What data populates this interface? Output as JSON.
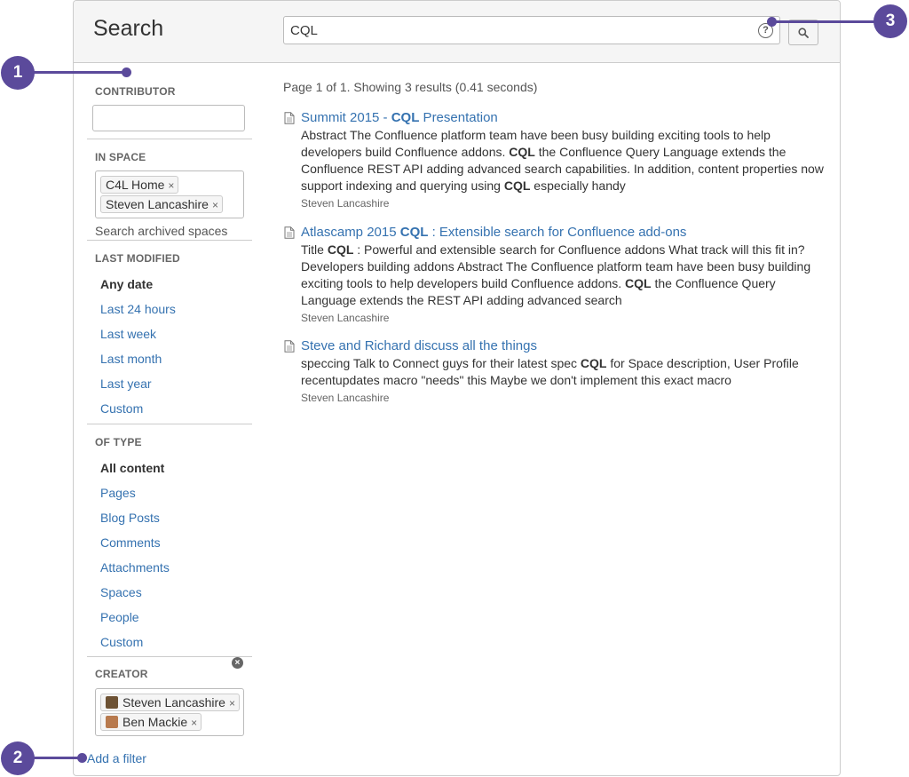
{
  "header": {
    "title": "Search",
    "query": "CQL",
    "help_glyph": "?"
  },
  "sidebar": {
    "contributor": {
      "title": "CONTRIBUTOR",
      "value": ""
    },
    "in_space": {
      "title": "IN SPACE",
      "chips": [
        "C4L Home",
        "Steven Lancashire"
      ],
      "archived_label": "Search archived spaces"
    },
    "last_modified": {
      "title": "LAST MODIFIED",
      "options": [
        "Any date",
        "Last 24 hours",
        "Last week",
        "Last month",
        "Last year",
        "Custom"
      ],
      "selected": "Any date"
    },
    "of_type": {
      "title": "OF TYPE",
      "options": [
        "All content",
        "Pages",
        "Blog Posts",
        "Comments",
        "Attachments",
        "Spaces",
        "People",
        "Custom"
      ],
      "selected": "All content"
    },
    "creator": {
      "title": "CREATOR",
      "chips": [
        "Steven Lancashire",
        "Ben Mackie"
      ]
    },
    "add_filter": "Add a filter",
    "chip_remove_glyph": "×"
  },
  "results": {
    "summary": "Page 1 of 1. Showing 3 results (0.41 seconds)",
    "items": [
      {
        "title_pre": "Summit 2015 - ",
        "title_bold": "CQL",
        "title_post": " Presentation",
        "excerpt": [
          {
            "t": "Abstract The Confluence platform team have been busy building exciting tools to help developers build Confluence addons. "
          },
          {
            "b": "CQL"
          },
          {
            "t": " the Confluence Query Language extends the Confluence REST API adding advanced search capabilities. In addition, content properties now support indexing and querying using "
          },
          {
            "b": "CQL"
          },
          {
            "t": " especially handy"
          }
        ],
        "author": "Steven Lancashire"
      },
      {
        "title_pre": "Atlascamp 2015 ",
        "title_bold": "CQL",
        "title_post": " : Extensible search for Confluence add-ons",
        "excerpt": [
          {
            "t": "Title "
          },
          {
            "b": "CQL"
          },
          {
            "t": " : Powerful and extensible search for Confluence addons What track will this fit in? Developers building addons Abstract The Confluence platform team have been busy building exciting tools to help developers build Confluence addons. "
          },
          {
            "b": "CQL"
          },
          {
            "t": " the Confluence Query Language extends the REST API adding advanced search"
          }
        ],
        "author": "Steven Lancashire"
      },
      {
        "title_pre": "Steve and Richard discuss all the things",
        "title_bold": "",
        "title_post": "",
        "excerpt": [
          {
            "t": "speccing Talk to Connect guys for their latest spec "
          },
          {
            "b": "CQL"
          },
          {
            "t": " for Space description, User Profile recentupdates macro \"needs\" this Maybe we don't implement this exact macro"
          }
        ],
        "author": "Steven Lancashire"
      }
    ]
  },
  "callouts": [
    "1",
    "2",
    "3"
  ],
  "colors": {
    "link": "#3572b0",
    "callout": "#5b4a9b",
    "header_bg": "#f5f5f5"
  }
}
